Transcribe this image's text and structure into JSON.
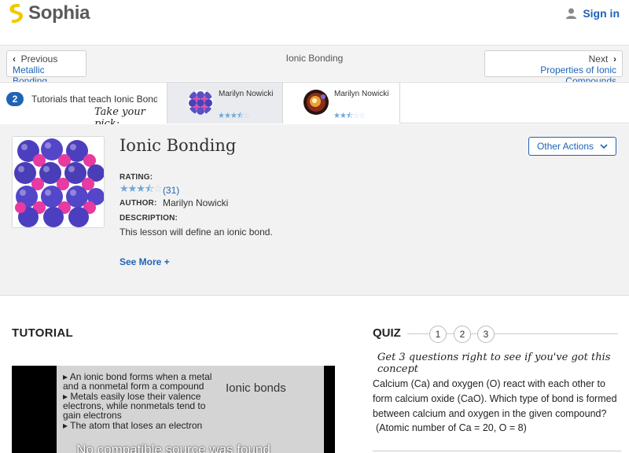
{
  "header": {
    "brand": "Sophia",
    "signin_label": "Sign in"
  },
  "nav": {
    "prev_dir": "Previous",
    "prev_target": "Metallic Bonding",
    "current": "Ionic Bonding",
    "next_dir": "Next",
    "next_target": "Properties of Ionic Compounds"
  },
  "picker": {
    "count": "2",
    "label": "Tutorials that teach Ionic Bonding",
    "hint": "Take your pick:",
    "cards": [
      {
        "author": "Marilyn Nowicki",
        "rating": 3.5
      },
      {
        "author": "Marilyn Nowicki",
        "rating": 2.5
      }
    ]
  },
  "lesson": {
    "title": "Ionic Bonding",
    "other_actions": "Other Actions",
    "rating_label": "RATING:",
    "rating": 3.5,
    "rating_count": "(31)",
    "author_label": "AUTHOR:",
    "author": "Marilyn Nowicki",
    "description_label": "DESCRIPTION:",
    "description": "This lesson will define an ionic bond.",
    "see_more": "See More +"
  },
  "tutorial": {
    "heading": "TUTORIAL",
    "slide_title": "Ionic bonds",
    "slide_bullets": [
      "An ionic bond forms when a metal and a nonmetal form a compound",
      "Metals easily lose their valence electrons, while nonmetals tend to gain electrons",
      "The atom that loses an electron"
    ],
    "video_error": "No compatible source was found"
  },
  "quiz": {
    "heading": "QUIZ",
    "numbers": [
      "1",
      "2",
      "3"
    ],
    "hint": "Get 3 questions right to see if you've got this concept",
    "question": "Calcium (Ca) and oxygen (O) react with each other to form calcium oxide (CaO). Which type of bond is formed between calcium and oxygen in the given compound?",
    "question_sub": "(Atomic number of Ca = 20, O = 8)"
  },
  "colors": {
    "brand_blue": "#1f63b5",
    "logo_yellow": "#f2c900",
    "star_blue": "#6fa8dc"
  }
}
